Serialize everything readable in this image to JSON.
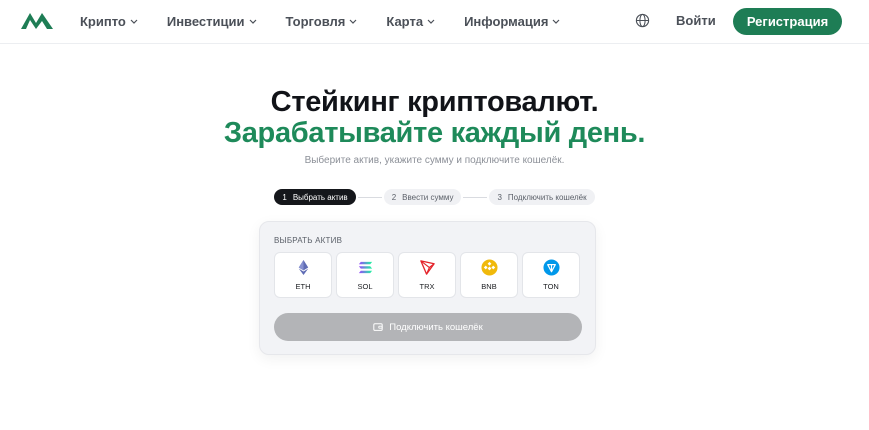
{
  "nav": {
    "items": [
      {
        "label": "Крипто"
      },
      {
        "label": "Инвестиции"
      },
      {
        "label": "Торговля"
      },
      {
        "label": "Карта"
      },
      {
        "label": "Информация"
      }
    ],
    "login_label": "Войти",
    "register_label": "Регистрация"
  },
  "hero": {
    "title": "Стейкинг криптовалют.",
    "subtitle": "Зарабатывайте каждый день.",
    "description": "Выберите актив, укажите сумму и подключите кошелёк."
  },
  "steps": [
    {
      "num": "1",
      "label": "Выбрать актив",
      "active": true
    },
    {
      "num": "2",
      "label": "Ввести сумму",
      "active": false
    },
    {
      "num": "3",
      "label": "Подключить кошелёк",
      "active": false
    }
  ],
  "card": {
    "label": "ВЫБРАТЬ АКТИВ",
    "assets": [
      {
        "name": "ETH",
        "icon": "ethereum-icon"
      },
      {
        "name": "SOL",
        "icon": "solana-icon"
      },
      {
        "name": "TRX",
        "icon": "tron-icon"
      },
      {
        "name": "BNB",
        "icon": "bnb-icon"
      },
      {
        "name": "TON",
        "icon": "ton-icon"
      }
    ],
    "connect_label": "Подключить кошелёк"
  },
  "colors": {
    "brand": "#1e7d55",
    "accent_text": "#1e8a5a",
    "disabled_button": "#b3b4b7"
  }
}
